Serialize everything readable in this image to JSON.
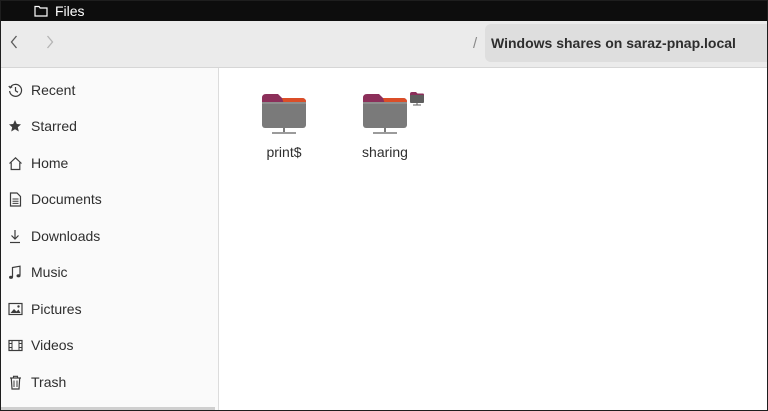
{
  "window": {
    "app_title": "Files",
    "app_icon": "folder-icon"
  },
  "header": {
    "back_icon": "chevron-left-icon",
    "forward_icon": "chevron-right-icon",
    "path_separator": "/",
    "current_location": "Windows shares on saraz-pnap.local"
  },
  "sidebar": {
    "items": [
      {
        "label": "Recent",
        "icon": "clock-icon"
      },
      {
        "label": "Starred",
        "icon": "star-icon"
      },
      {
        "label": "Home",
        "icon": "home-icon"
      },
      {
        "label": "Documents",
        "icon": "document-icon"
      },
      {
        "label": "Downloads",
        "icon": "download-icon"
      },
      {
        "label": "Music",
        "icon": "music-icon"
      },
      {
        "label": "Pictures",
        "icon": "picture-icon"
      },
      {
        "label": "Videos",
        "icon": "video-icon"
      },
      {
        "label": "Trash",
        "icon": "trash-icon"
      }
    ]
  },
  "content": {
    "shares": [
      {
        "label": "print$",
        "icon": "network-folder-icon"
      },
      {
        "label": "sharing",
        "icon": "network-folder-icon",
        "emblem": "shared-emblem-icon"
      }
    ]
  },
  "colors": {
    "folder_tab": "#8c2f5a",
    "folder_body": "#7a7a7a",
    "folder_accent": "#e95420",
    "topbar": "#0d0d0d",
    "headerbar": "#ebebeb"
  }
}
